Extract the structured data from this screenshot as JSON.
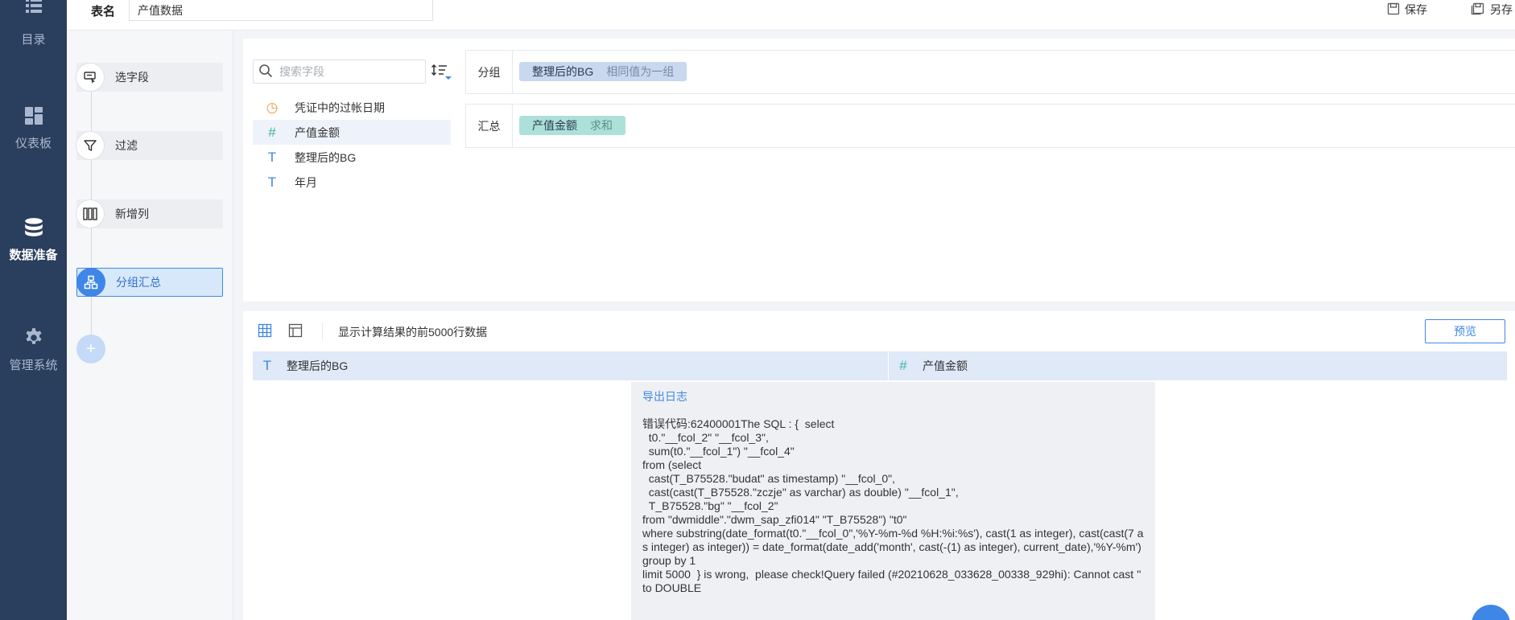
{
  "nav": {
    "items": [
      {
        "label": "目录",
        "icon": "list-icon",
        "active": false
      },
      {
        "label": "仪表板",
        "icon": "dashboard-icon",
        "active": false
      },
      {
        "label": "数据准备",
        "icon": "database-icon",
        "active": true
      },
      {
        "label": "管理系统",
        "icon": "gear-icon",
        "active": false
      }
    ]
  },
  "topbar": {
    "table_label": "表名",
    "table_name": "产值数据",
    "save_label": "保存",
    "save_as_label": "另存"
  },
  "steps": {
    "items": [
      {
        "label": "选字段",
        "icon": "select-field-icon"
      },
      {
        "label": "过滤",
        "icon": "filter-icon"
      },
      {
        "label": "新增列",
        "icon": "add-column-icon"
      },
      {
        "label": "分组汇总",
        "icon": "group-summary-icon",
        "active": true
      }
    ],
    "add_label": "+"
  },
  "config": {
    "search_placeholder": "搜索字段",
    "fields": [
      {
        "label": "凭证中的过帐日期",
        "type": "date",
        "type_glyph": "◷"
      },
      {
        "label": "产值金额",
        "type": "number",
        "type_glyph": "#"
      },
      {
        "label": "整理后的BG",
        "type": "text",
        "type_glyph": "T"
      },
      {
        "label": "年月",
        "type": "text",
        "type_glyph": "T"
      }
    ],
    "group": {
      "label": "分组",
      "chip_field": "整理后的BG",
      "chip_agg": "相同值为一组"
    },
    "summary": {
      "label": "汇总",
      "chip_field": "产值金额",
      "chip_agg": "求和"
    }
  },
  "result": {
    "note": "显示计算结果的前5000行数据",
    "preview_label": "预览",
    "columns": [
      {
        "label": "整理后的BG",
        "type_glyph": "T"
      },
      {
        "label": "产值金额",
        "type_glyph": "#"
      }
    ],
    "error": {
      "export_log": "导出日志",
      "text": "错误代码:62400001The SQL : {  select\n  t0.\"__fcol_2\" \"__fcol_3\",\n  sum(t0.\"__fcol_1\") \"__fcol_4\"\nfrom (select\n  cast(T_B75528.\"budat\" as timestamp) \"__fcol_0\",\n  cast(cast(T_B75528.\"zczje\" as varchar) as double) \"__fcol_1\",\n  T_B75528.\"bg\" \"__fcol_2\"\nfrom \"dwmiddle\".\"dwm_sap_zfi014\" \"T_B75528\") \"t0\"\nwhere substring(date_format(t0.\"__fcol_0\",'%Y-%m-%d %H:%i:%s'), cast(1 as integer), cast(cast(7 as integer) as integer)) = date_format(date_add('month', cast(-(1) as integer), current_date),'%Y-%m')\ngroup by 1\nlimit 5000  } is wrong,  please check!Query failed (#20210628_033628_00338_929hi): Cannot cast '' to DOUBLE"
    }
  },
  "colors": {
    "nav_bg": "#2a3e5d",
    "accent": "#3f87e6",
    "group_chip": "#c9d8ef",
    "sum_chip": "#ade0d8"
  }
}
